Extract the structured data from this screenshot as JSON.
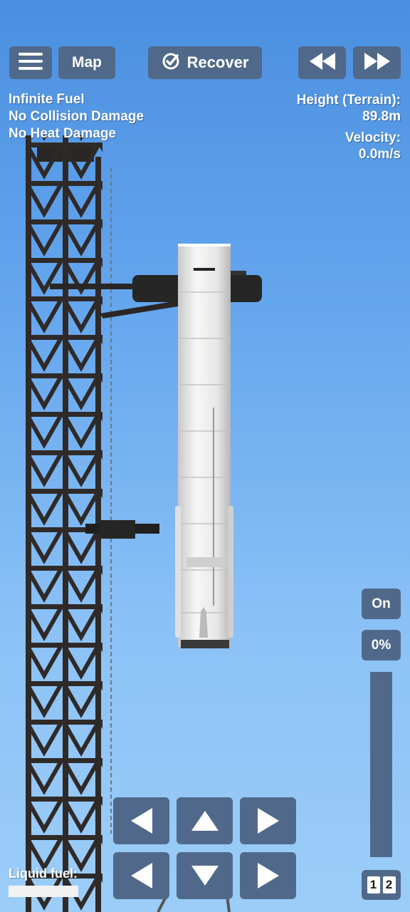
{
  "toolbar": {
    "map_label": "Map",
    "recover_label": "Recover"
  },
  "cheats": {
    "line1": "Infinite Fuel",
    "line2": "No Collision Damage",
    "line3": "No Heat Damage"
  },
  "telemetry": {
    "height_label": "Height (Terrain):",
    "height_value": "89.8m",
    "velocity_label": "Velocity:",
    "velocity_value": "0.0m/s"
  },
  "side_panel": {
    "engine_toggle_label": "On",
    "throttle_label": "0%",
    "throttle_fraction": 0.0,
    "stage_1": "1",
    "stage_2": "2"
  },
  "fuel": {
    "label": "Liquid fuel:",
    "fraction": 1.0
  },
  "icons": {
    "menu": "hamburger-icon",
    "recover": "check-circle-icon",
    "rewind": "rewind-icon",
    "fast_forward": "fast-forward-icon"
  },
  "colors": {
    "button_bg": "#50698a",
    "sky_top": "#4a8fe0",
    "sky_bottom": "#9ccdf8"
  }
}
